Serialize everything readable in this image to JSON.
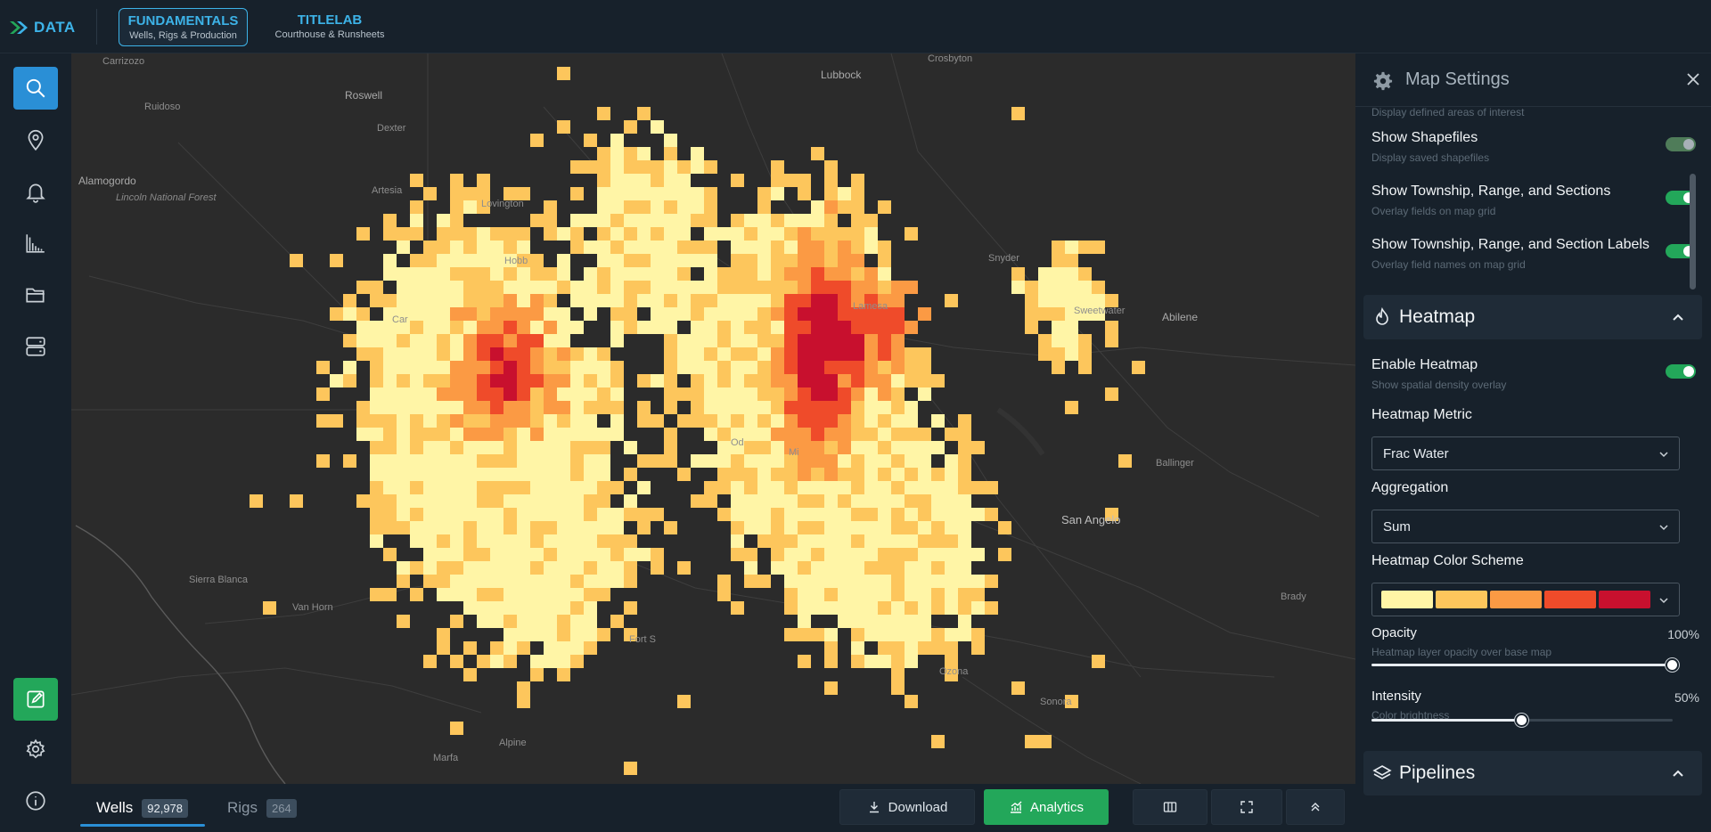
{
  "app": {
    "logo_text": "DATA",
    "products": [
      {
        "title": "FUNDAMENTALS",
        "subtitle": "Wells, Rigs & Production"
      },
      {
        "title": "TITLELAB",
        "subtitle": "Courthouse & Runsheets"
      }
    ]
  },
  "rail": {
    "icons": [
      "search-icon",
      "map-pin-icon",
      "bell-icon",
      "chart-icon",
      "folder-icon",
      "server-icon",
      "edit-icon",
      "gear-icon",
      "info-icon"
    ]
  },
  "map": {
    "places": [
      {
        "name": "Carrizozo",
        "cls": "small"
      },
      {
        "name": "Roswell",
        "cls": ""
      },
      {
        "name": "Ruidoso",
        "cls": "small"
      },
      {
        "name": "Dexter",
        "cls": "small"
      },
      {
        "name": "Alamogordo",
        "cls": ""
      },
      {
        "name": "Lincoln National Forest",
        "cls": "ital"
      },
      {
        "name": "Artesia",
        "cls": "small"
      },
      {
        "name": "Lovington",
        "cls": "small"
      },
      {
        "name": "Hobb",
        "cls": "small"
      },
      {
        "name": "Car",
        "cls": "small"
      },
      {
        "name": "Lubbock",
        "cls": ""
      },
      {
        "name": "Crosbyton",
        "cls": "small"
      },
      {
        "name": "Snyder",
        "cls": "small"
      },
      {
        "name": "Sweetwater",
        "cls": "small"
      },
      {
        "name": "Abilene",
        "cls": ""
      },
      {
        "name": "Ballinger",
        "cls": "small"
      },
      {
        "name": "San Angelo",
        "cls": "big"
      },
      {
        "name": "Brady",
        "cls": "small"
      },
      {
        "name": "Sierra Blanca",
        "cls": "small"
      },
      {
        "name": "Van Horn",
        "cls": "small"
      },
      {
        "name": "Fort S",
        "cls": "small"
      },
      {
        "name": "Ozona",
        "cls": "small"
      },
      {
        "name": "Sonora",
        "cls": "small"
      },
      {
        "name": "Alpine",
        "cls": "small"
      },
      {
        "name": "Marfa",
        "cls": "small"
      },
      {
        "name": "Od",
        "cls": "small"
      },
      {
        "name": "Mi",
        "cls": "small"
      },
      {
        "name": "Lamesa",
        "cls": "small"
      }
    ],
    "tools": [
      "print-icon",
      "expand-panel-icon",
      "compass-icon",
      "zoom-in-icon",
      "zoom-out-icon",
      "measure-icon",
      "wrench-icon"
    ]
  },
  "bottom": {
    "wells_label": "Wells",
    "wells_count": "92,978",
    "rigs_label": "Rigs",
    "rigs_count": "264",
    "download_label": "Download",
    "analytics_label": "Analytics"
  },
  "panel": {
    "title": "Map Settings",
    "truncated_sub": "Display defined areas of interest",
    "show_shapefiles": {
      "label": "Show Shapefiles",
      "sub": "Display saved shapefiles",
      "on": false
    },
    "show_trs": {
      "label": "Show Township, Range, and Sections",
      "sub": "Overlay fields on map grid",
      "on": true
    },
    "show_trs_labels": {
      "label": "Show Township, Range, and Section Labels",
      "sub": "Overlay field names on map grid",
      "on": true
    },
    "heatmap_section": "Heatmap",
    "enable_heatmap": {
      "label": "Enable Heatmap",
      "sub": "Show spatial density overlay",
      "on": true
    },
    "metric": {
      "label": "Heatmap Metric",
      "value": "Frac Water"
    },
    "aggregation": {
      "label": "Aggregation",
      "value": "Sum"
    },
    "color_scheme": {
      "label": "Heatmap Color Scheme",
      "colors": [
        "#fff5a6",
        "#fdc65c",
        "#fb9a44",
        "#ef4b2a",
        "#c8102e"
      ]
    },
    "opacity": {
      "label": "Opacity",
      "value_text": "100%",
      "sub": "Heatmap layer opacity over base map",
      "value": 1.0
    },
    "intensity": {
      "label": "Intensity",
      "value_text": "50%",
      "sub": "Color brightness",
      "value": 0.5
    },
    "pipelines_section": "Pipelines"
  }
}
